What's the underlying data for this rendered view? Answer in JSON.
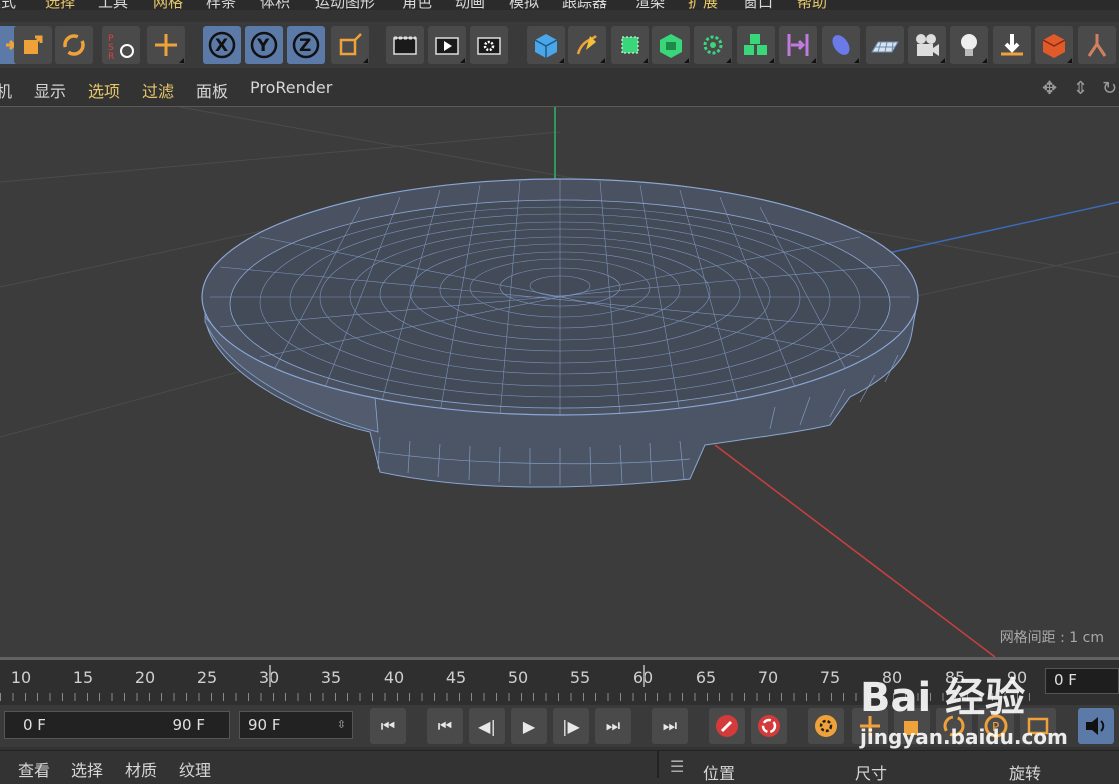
{
  "menubar": {
    "items": [
      "模式",
      "选择",
      "工具",
      "网格",
      "样条",
      "体积",
      "运动图形",
      "角色",
      "动画",
      "模拟",
      "跟踪器",
      "渲染",
      "扩展",
      "窗口",
      "帮助"
    ]
  },
  "toolbar": {
    "icons": [
      "move-tool-icon",
      "scale-tool-icon",
      "rotate-tool-icon",
      "psr-reset-icon",
      "axis-move-icon",
      "x-axis-lock-icon",
      "y-axis-lock-icon",
      "z-axis-lock-icon",
      "coordinate-system-icon",
      "render-view-icon",
      "render-to-picture-viewer-icon",
      "render-settings-icon",
      "cube-object-icon",
      "pen-spline-icon",
      "subdivision-surface-icon",
      "extrude-generator-icon",
      "array-deformer-icon",
      "cloner-icon",
      "bend-deformer-icon",
      "deformer-icon",
      "floor-object-icon",
      "camera-icon",
      "light-icon",
      "drop-to-floor-icon",
      "material-icon",
      "character-icon"
    ]
  },
  "viewport_menu": {
    "items": [
      "机",
      "显示",
      "选项",
      "过滤",
      "面板",
      "ProRender"
    ],
    "accent_color": "#e5c76a"
  },
  "viewport": {
    "grid_spacing": "网格间距 : 1 cm",
    "axis_colors": {
      "x": "#c84040",
      "y": "#2fb36a",
      "z": "#3a6ab8"
    },
    "wire_color": "#8aa6d4"
  },
  "timeline": {
    "ticks": [
      "10",
      "15",
      "20",
      "25",
      "30",
      "35",
      "40",
      "45",
      "50",
      "55",
      "60",
      "65",
      "70",
      "75",
      "80",
      "85",
      "90"
    ],
    "current_frame": "0 F"
  },
  "playback": {
    "range_start": "0 F",
    "range_end": "90 F",
    "max_frame": "90 F"
  },
  "bottom_panel": {
    "tabs": [
      "查看",
      "选择",
      "材质",
      "纹理"
    ],
    "attributes": [
      "位置",
      "尺寸",
      "旋转"
    ]
  },
  "watermark": {
    "logo": "Bai 经验",
    "url": "jingyan.baidu.com"
  }
}
